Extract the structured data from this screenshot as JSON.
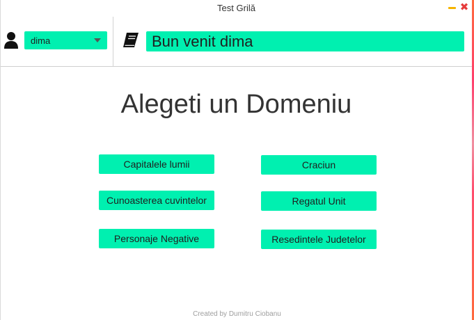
{
  "window": {
    "title": "Test Grilă",
    "controls": {
      "minimize_color": "#f6b400",
      "close_color": "#e63c3c",
      "close_glyph": "✖"
    }
  },
  "header": {
    "user_icon": "user-icon",
    "user_select": {
      "value": "dima"
    },
    "book_icon": "book-icon",
    "welcome_text": "Bun venit dima"
  },
  "main": {
    "title": "Alegeti un Domeniu",
    "domains": [
      {
        "label": "Capitalele lumii"
      },
      {
        "label": "Craciun"
      },
      {
        "label": "Cunoasterea cuvintelor"
      },
      {
        "label": "Regatul Unit"
      },
      {
        "label": "Personaje Negative"
      },
      {
        "label": "Resedintele Judetelor"
      }
    ]
  },
  "footer": {
    "credit": "Created by Dumitru Ciobanu"
  },
  "colors": {
    "accent": "#00f0b0",
    "text": "#333333"
  }
}
